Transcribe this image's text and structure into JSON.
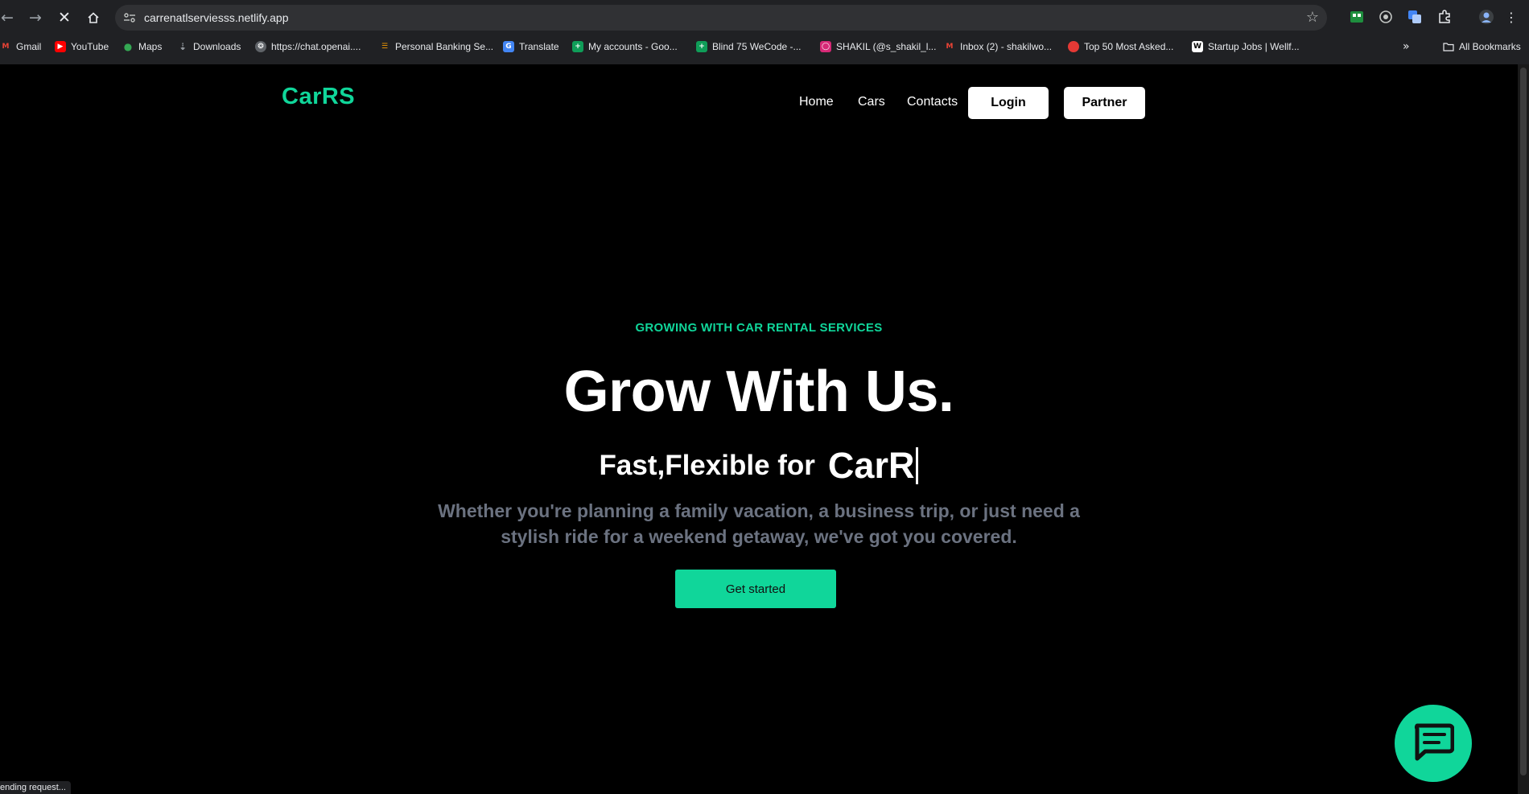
{
  "browser": {
    "url": "carrenatlserviesss.netlify.app",
    "status_text": "ending request...",
    "bookmarks": [
      {
        "label": "Gmail",
        "icon": "gmail-icon",
        "color": "#ea4335"
      },
      {
        "label": "YouTube",
        "icon": "youtube-icon",
        "color": "#ff0000"
      },
      {
        "label": "Maps",
        "icon": "maps-pin-icon",
        "color": "#34a853"
      },
      {
        "label": "Downloads",
        "icon": "download-icon",
        "color": "#9aa0a6"
      },
      {
        "label": "https://chat.openai....",
        "icon": "openai-icon",
        "color": "#5f6368"
      },
      {
        "label": "Personal Banking Se...",
        "icon": "bank-icon",
        "color": "#f29900"
      },
      {
        "label": "Translate",
        "icon": "translate-icon",
        "color": "#4285f4"
      },
      {
        "label": "My accounts - Goo...",
        "icon": "sheets-icon",
        "color": "#0f9d58"
      },
      {
        "label": "Blind 75 WeCode -...",
        "icon": "sheets-icon",
        "color": "#0f9d58"
      },
      {
        "label": "SHAKIL (@s_shakil_l...",
        "icon": "instagram-icon",
        "color": "#d62976"
      },
      {
        "label": "Inbox (2) - shakilwo...",
        "icon": "gmail-icon",
        "color": "#ea4335"
      },
      {
        "label": "Top 50 Most Asked...",
        "icon": "circle-icon",
        "color": "#e53935"
      },
      {
        "label": "Startup Jobs | Wellf...",
        "icon": "w-icon",
        "color": "#ffffff"
      }
    ],
    "all_bookmarks_label": "All Bookmarks"
  },
  "site": {
    "logo": "CarRS",
    "nav": {
      "home": "Home",
      "cars": "Cars",
      "contacts": "Contacts",
      "login": "Login",
      "partner": "Partner"
    },
    "hero": {
      "eyebrow": "GROWING WITH CAR RENTAL SERVICES",
      "title": "Grow With Us.",
      "subtitle_prefix": "Fast,Flexible for",
      "typed_word": "CarR",
      "description": "Whether you're planning a family vacation, a business trip, or just need a stylish ride for a weekend getaway, we've got you covered.",
      "cta": "Get started"
    }
  },
  "colors": {
    "accent": "#10d69a",
    "background": "#000000",
    "muted_text": "#6b7280"
  }
}
